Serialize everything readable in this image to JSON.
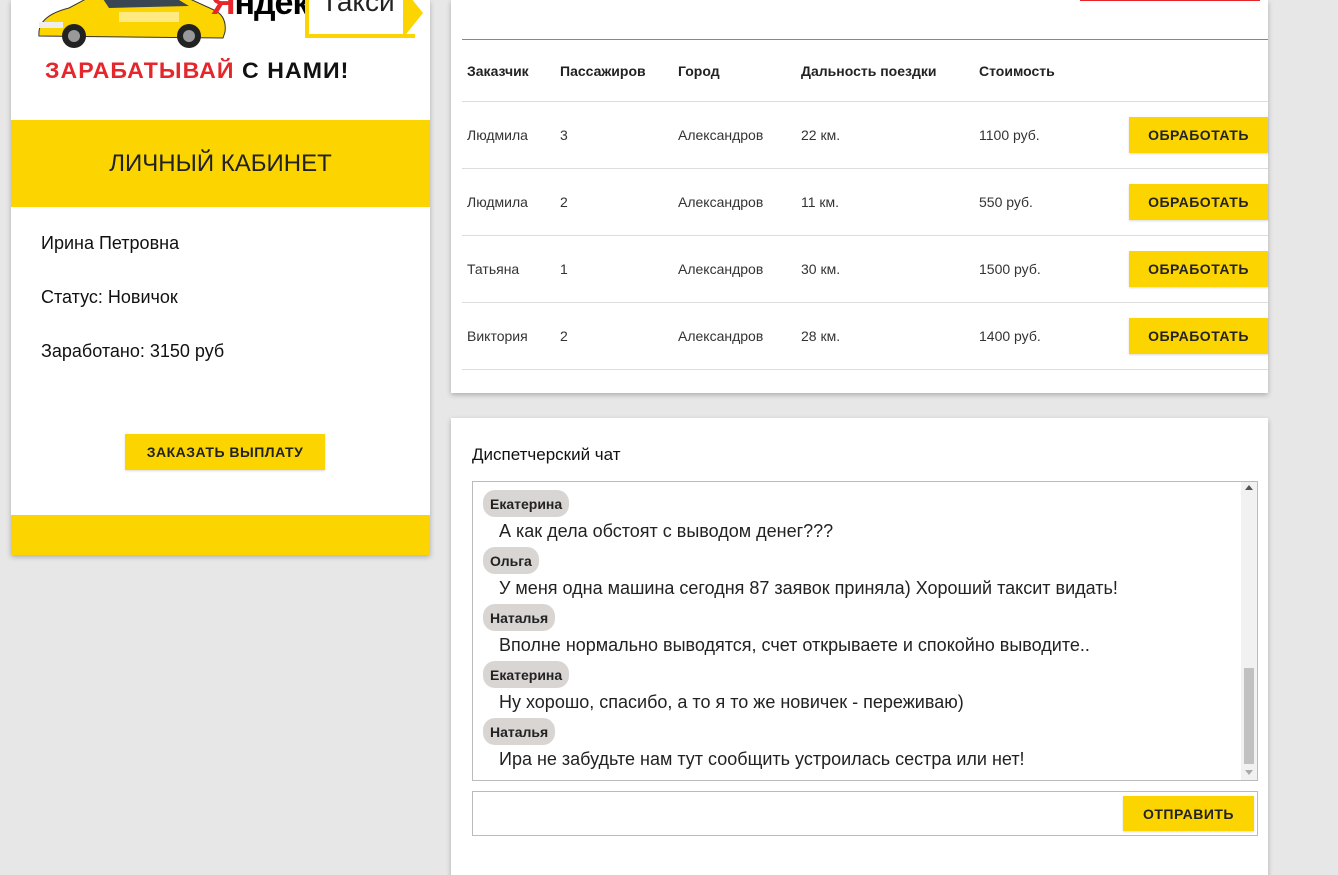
{
  "brand": {
    "logo_yandex": "Яндекс",
    "logo_taxi": "Такси",
    "slogan_red": "ЗАРАБАТЫВАЙ",
    "slogan_black": "С НАМИ!",
    "colors": {
      "yellow": "#fcd500",
      "red": "#e5262b"
    }
  },
  "cabinet": {
    "title": "ЛИЧНЫЙ КАБИНЕТ",
    "user_name": "Ирина Петровна",
    "status": "Статус: Новичок",
    "earned": "Заработано: 3150 руб",
    "payout_button": "ЗАКАЗАТЬ ВЫПЛАТУ"
  },
  "orders": {
    "headers": [
      "Заказчик",
      "Пассажиров",
      "Город",
      "Дальность поездки",
      "Стоимость"
    ],
    "rows": [
      {
        "customer": "Людмила",
        "passengers": "3",
        "city": "Александров",
        "distance": "22 км.",
        "price": "1100 руб."
      },
      {
        "customer": "Людмила",
        "passengers": "2",
        "city": "Александров",
        "distance": "11 км.",
        "price": "550 руб."
      },
      {
        "customer": "Татьяна",
        "passengers": "1",
        "city": "Александров",
        "distance": "30 км.",
        "price": "1500 руб."
      },
      {
        "customer": "Виктория",
        "passengers": "2",
        "city": "Александров",
        "distance": "28 км.",
        "price": "1400 руб."
      }
    ],
    "process_button": "ОБРАБОТАТЬ"
  },
  "chat": {
    "title": "Диспетчерский чат",
    "messages": [
      {
        "author": "Екатерина",
        "text": "А как дела обстоят с выводом денег???"
      },
      {
        "author": "Ольга",
        "text": "У меня одна машина сегодня 87 заявок приняла) Хороший таксит видать!"
      },
      {
        "author": "Наталья",
        "text": "Вполне нормально выводятся, счет открываете и спокойно выводите.."
      },
      {
        "author": "Екатерина",
        "text": "Ну хорошо, спасибо, а то я то же новичек - переживаю)"
      },
      {
        "author": "Наталья",
        "text": "Ира не забудьте нам тут сообщить устроилась сестра или нет!"
      }
    ],
    "input_value": "",
    "send_button": "ОТПРАВИТЬ"
  }
}
